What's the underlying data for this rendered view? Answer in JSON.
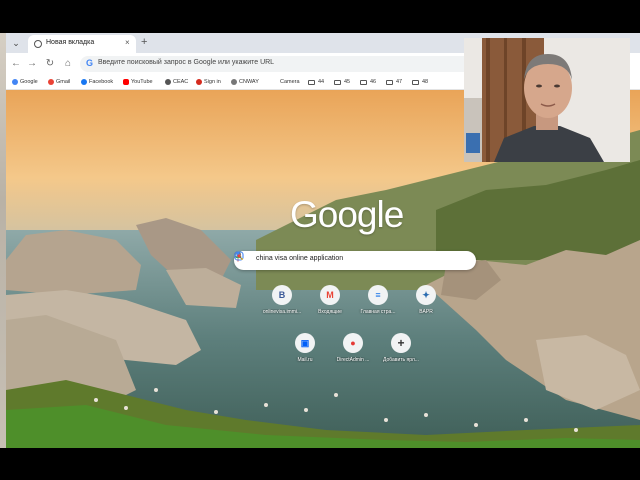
{
  "browser": {
    "tab": {
      "title": "Новая вкладка",
      "close": "×"
    },
    "new_tab": "+",
    "nav": {
      "back": "←",
      "forward": "→",
      "reload": "↻",
      "home": "⌂"
    },
    "omnibox": {
      "placeholder": "Введите поисковый запрос в Google или укажите URL"
    }
  },
  "bookmarks": [
    {
      "label": "Google",
      "icon": "google-icon",
      "color": "#4285f4"
    },
    {
      "label": "Gmail",
      "icon": "gmail-icon",
      "color": "#ea4335"
    },
    {
      "label": "Facebook",
      "icon": "facebook-icon",
      "color": "#1877f2"
    },
    {
      "label": "YouTube",
      "icon": "youtube-icon",
      "color": "#ff0000"
    },
    {
      "label": "CEAC",
      "icon": "ceac-icon",
      "color": "#555555"
    },
    {
      "label": "Sign in",
      "icon": "maple-leaf-icon",
      "color": "#d52b1e"
    },
    {
      "label": "CNWAY",
      "icon": "cnway-icon",
      "color": "#777777"
    },
    {
      "label": "Camera",
      "icon": "folder-icon"
    },
    {
      "label": "44",
      "icon": "folder-icon"
    },
    {
      "label": "45",
      "icon": "folder-icon"
    },
    {
      "label": "46",
      "icon": "folder-icon"
    },
    {
      "label": "47",
      "icon": "folder-icon"
    },
    {
      "label": "48",
      "icon": "folder-icon"
    }
  ],
  "newtab": {
    "logo": "Google",
    "search_value": "china visa online application",
    "shortcuts": [
      {
        "label": "onlinevisa.immi...",
        "glyph": "B",
        "color": "#3b5998"
      },
      {
        "label": "Входящие",
        "glyph": "M",
        "color": "#ea4335"
      },
      {
        "label": "Главная стра...",
        "glyph": "≡",
        "color": "#1a73e8"
      },
      {
        "label": "BAPR",
        "glyph": "✦",
        "color": "#2b6cb0"
      },
      {
        "label": "Mail.ru",
        "glyph": "▣",
        "color": "#005ff9"
      },
      {
        "label": "DirectAdmin ...",
        "glyph": "●",
        "color": "#e53935"
      },
      {
        "label": "Добавить ярл...",
        "glyph": "+",
        "color": "#333333"
      }
    ]
  }
}
